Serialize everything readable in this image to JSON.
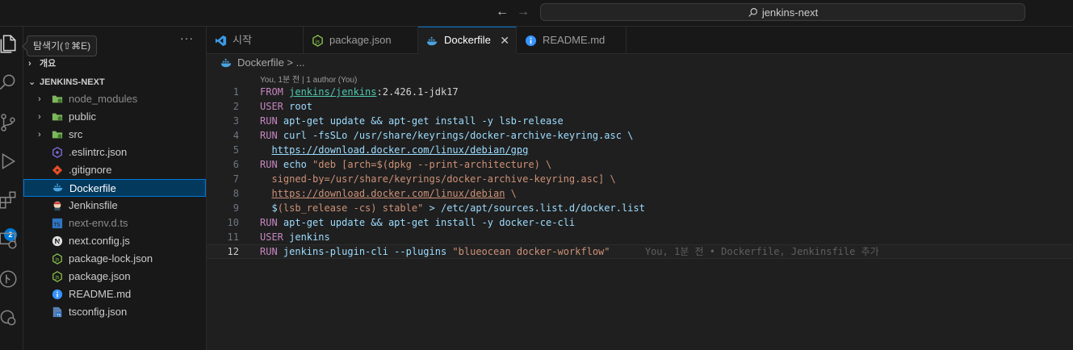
{
  "titlebar": {
    "search_text": "jenkins-next"
  },
  "tooltip": "탐색기(⇧⌘E)",
  "activity_badge": "2",
  "explorer": {
    "outline_label": "개요",
    "project_label": "JENKINS-NEXT",
    "items": [
      {
        "name": "node_modules",
        "type": "folder",
        "dim": true
      },
      {
        "name": "public",
        "type": "folder",
        "dim": false
      },
      {
        "name": "src",
        "type": "folder",
        "dim": false
      },
      {
        "name": ".eslintrc.json",
        "type": "eslint",
        "dim": false
      },
      {
        "name": ".gitignore",
        "type": "git",
        "dim": false
      },
      {
        "name": "Dockerfile",
        "type": "docker",
        "dim": false,
        "selected": true
      },
      {
        "name": "Jenkinsfile",
        "type": "jenkins",
        "dim": false
      },
      {
        "name": "next-env.d.ts",
        "type": "ts",
        "dim": true
      },
      {
        "name": "next.config.js",
        "type": "next",
        "dim": false
      },
      {
        "name": "package-lock.json",
        "type": "node",
        "dim": false
      },
      {
        "name": "package.json",
        "type": "node",
        "dim": false
      },
      {
        "name": "README.md",
        "type": "info",
        "dim": false
      },
      {
        "name": "tsconfig.json",
        "type": "tsconfig",
        "dim": false
      }
    ]
  },
  "tabs": [
    {
      "label": "시작",
      "icon": "vscode-icon",
      "active": false
    },
    {
      "label": "package.json",
      "icon": "node-icon",
      "active": false
    },
    {
      "label": "Dockerfile",
      "icon": "docker-icon",
      "active": true,
      "close": "✕"
    },
    {
      "label": "README.md",
      "icon": "info-icon",
      "active": false
    }
  ],
  "breadcrumb": "Dockerfile > ...",
  "codelens": "You, 1분 전 | 1 author (You)",
  "code_lines": [
    {
      "num": "1",
      "tokens": [
        [
          "kw",
          "FROM "
        ],
        [
          "img",
          "jenkins/jenkins"
        ],
        [
          "plain",
          ":2.426.1-jdk17"
        ]
      ]
    },
    {
      "num": "2",
      "tokens": [
        [
          "kw",
          "USER "
        ],
        [
          "txt",
          "root"
        ]
      ]
    },
    {
      "num": "3",
      "tokens": [
        [
          "kw",
          "RUN "
        ],
        [
          "txt",
          "apt-get update && apt-get install -y lsb-release"
        ]
      ]
    },
    {
      "num": "4",
      "tokens": [
        [
          "kw",
          "RUN "
        ],
        [
          "txt",
          "curl -fsSLo /usr/share/keyrings/docker-archive-keyring.asc \\"
        ]
      ]
    },
    {
      "num": "5",
      "tokens": [
        [
          "plain",
          "  "
        ],
        [
          "url",
          "https://download.docker.com/linux/debian/gpg"
        ]
      ]
    },
    {
      "num": "6",
      "tokens": [
        [
          "kw",
          "RUN "
        ],
        [
          "txt",
          "echo "
        ],
        [
          "str",
          "\"deb [arch=$(dpkg --print-architecture) \\"
        ]
      ]
    },
    {
      "num": "7",
      "tokens": [
        [
          "str",
          "  signed-by=/usr/share/keyrings/docker-archive-keyring.asc] \\"
        ]
      ]
    },
    {
      "num": "8",
      "tokens": [
        [
          "plain",
          "  "
        ],
        [
          "surl",
          "https://download.docker.com/linux/debian"
        ],
        [
          "str",
          " \\"
        ]
      ]
    },
    {
      "num": "9",
      "tokens": [
        [
          "txt",
          "  $"
        ],
        [
          "str",
          "(lsb_release -cs) stable\""
        ],
        [
          "txt",
          " > /etc/apt/sources.list.d/docker.list"
        ]
      ]
    },
    {
      "num": "10",
      "tokens": [
        [
          "kw",
          "RUN "
        ],
        [
          "txt",
          "apt-get update && apt-get install -y docker-ce-cli"
        ]
      ]
    },
    {
      "num": "11",
      "tokens": [
        [
          "kw",
          "USER "
        ],
        [
          "txt",
          "jenkins"
        ]
      ]
    },
    {
      "num": "12",
      "tokens": [
        [
          "kw",
          "RUN "
        ],
        [
          "txt",
          "jenkins-plugin-cli --plugins "
        ],
        [
          "str",
          "\"blueocean docker-workflow\""
        ],
        [
          "blame",
          "      You, 1분 전 • Dockerfile, Jenkinsfile 추가"
        ]
      ]
    }
  ],
  "colors": {
    "accent": "#0078d4",
    "docker": "#4aa3df",
    "node": "#8cc84b",
    "info": "#3794ff"
  }
}
